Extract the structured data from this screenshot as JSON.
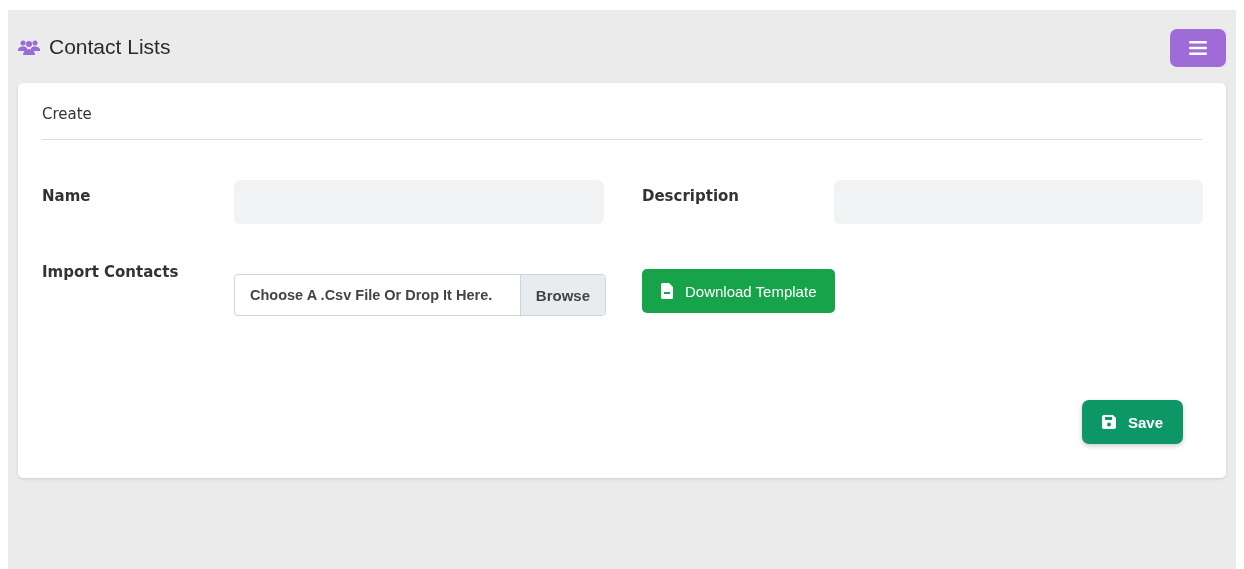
{
  "header": {
    "title": "Contact Lists"
  },
  "card": {
    "title": "Create",
    "fields": [
      {
        "label": "Name"
      },
      {
        "label": "Description"
      }
    ],
    "import": {
      "label": "Import Contacts",
      "file_text": "Choose A .Csv File Or Drop It Here.",
      "browse": "Browse"
    },
    "template_button": "Download Template",
    "save_button": "Save"
  }
}
